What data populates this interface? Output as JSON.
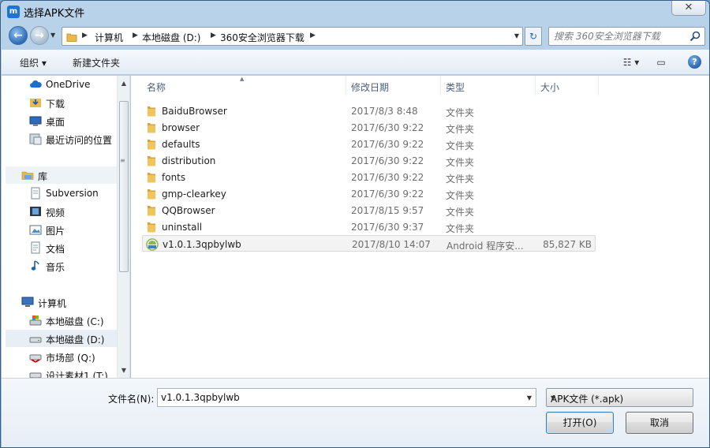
{
  "window": {
    "title": "选择APK文件",
    "app_icon_glyph": "m",
    "close_glyph": "✕"
  },
  "address": {
    "crumbs": [
      "计算机",
      "本地磁盘 (D:)",
      "360安全浏览器下载"
    ],
    "refresh_glyph": "↻"
  },
  "search": {
    "placeholder": "搜索 360安全浏览器下载"
  },
  "toolbar": {
    "organize": "组织 ▾",
    "new_folder": "新建文件夹",
    "view_glyph": "☷ ▾",
    "preview_glyph": "▭",
    "help_glyph": "?"
  },
  "sidebar": {
    "items": [
      {
        "label": "OneDrive",
        "icon": "cloud-icon"
      },
      {
        "label": "下载",
        "icon": "download-folder-icon"
      },
      {
        "label": "桌面",
        "icon": "desktop-icon"
      },
      {
        "label": "最近访问的位置",
        "icon": "recent-places-icon"
      },
      {
        "label": "库",
        "icon": "library-icon"
      },
      {
        "label": "Subversion",
        "icon": "document-library-icon"
      },
      {
        "label": "视频",
        "icon": "video-library-icon"
      },
      {
        "label": "图片",
        "icon": "picture-library-icon"
      },
      {
        "label": "文档",
        "icon": "document-library-icon"
      },
      {
        "label": "音乐",
        "icon": "music-library-icon"
      },
      {
        "label": "计算机",
        "icon": "computer-icon"
      },
      {
        "label": "本地磁盘 (C:)",
        "icon": "system-drive-icon"
      },
      {
        "label": "本地磁盘 (D:)",
        "icon": "drive-icon"
      },
      {
        "label": "市场部 (Q:)",
        "icon": "network-drive-icon"
      },
      {
        "label": "设计素材1 (T:)",
        "icon": "network-drive-icon"
      }
    ],
    "selected_index": 12
  },
  "columns": {
    "name": "名称",
    "date": "修改日期",
    "type": "类型",
    "size": "大小"
  },
  "files": [
    {
      "name": "BaiduBrowser",
      "date": "2017/8/3 8:48",
      "type": "文件夹",
      "size": "",
      "icon": "folder-icon"
    },
    {
      "name": "browser",
      "date": "2017/6/30 9:22",
      "type": "文件夹",
      "size": "",
      "icon": "folder-icon"
    },
    {
      "name": "defaults",
      "date": "2017/6/30 9:22",
      "type": "文件夹",
      "size": "",
      "icon": "folder-icon"
    },
    {
      "name": "distribution",
      "date": "2017/6/30 9:22",
      "type": "文件夹",
      "size": "",
      "icon": "folder-icon"
    },
    {
      "name": "fonts",
      "date": "2017/6/30 9:22",
      "type": "文件夹",
      "size": "",
      "icon": "folder-icon"
    },
    {
      "name": "gmp-clearkey",
      "date": "2017/6/30 9:22",
      "type": "文件夹",
      "size": "",
      "icon": "folder-icon"
    },
    {
      "name": "QQBrowser",
      "date": "2017/8/15 9:57",
      "type": "文件夹",
      "size": "",
      "icon": "folder-icon"
    },
    {
      "name": "uninstall",
      "date": "2017/6/30 9:37",
      "type": "文件夹",
      "size": "",
      "icon": "folder-icon"
    },
    {
      "name": "v1.0.1.3qpbylwb",
      "date": "2017/8/10 14:07",
      "type": "Android 程序安...",
      "size": "85,827 KB",
      "icon": "apk-icon"
    }
  ],
  "selected_file_index": 8,
  "footer": {
    "filename_label": "文件名(N):",
    "filename_value": "v1.0.1.3qpbylwb",
    "filter_value": "APK文件 (*.apk)",
    "open_label": "打开(O)",
    "cancel_label": "取消"
  },
  "colors": {
    "accent": "#1d74d8",
    "folder": "#f2c55c",
    "selection": "#e8eef5"
  }
}
